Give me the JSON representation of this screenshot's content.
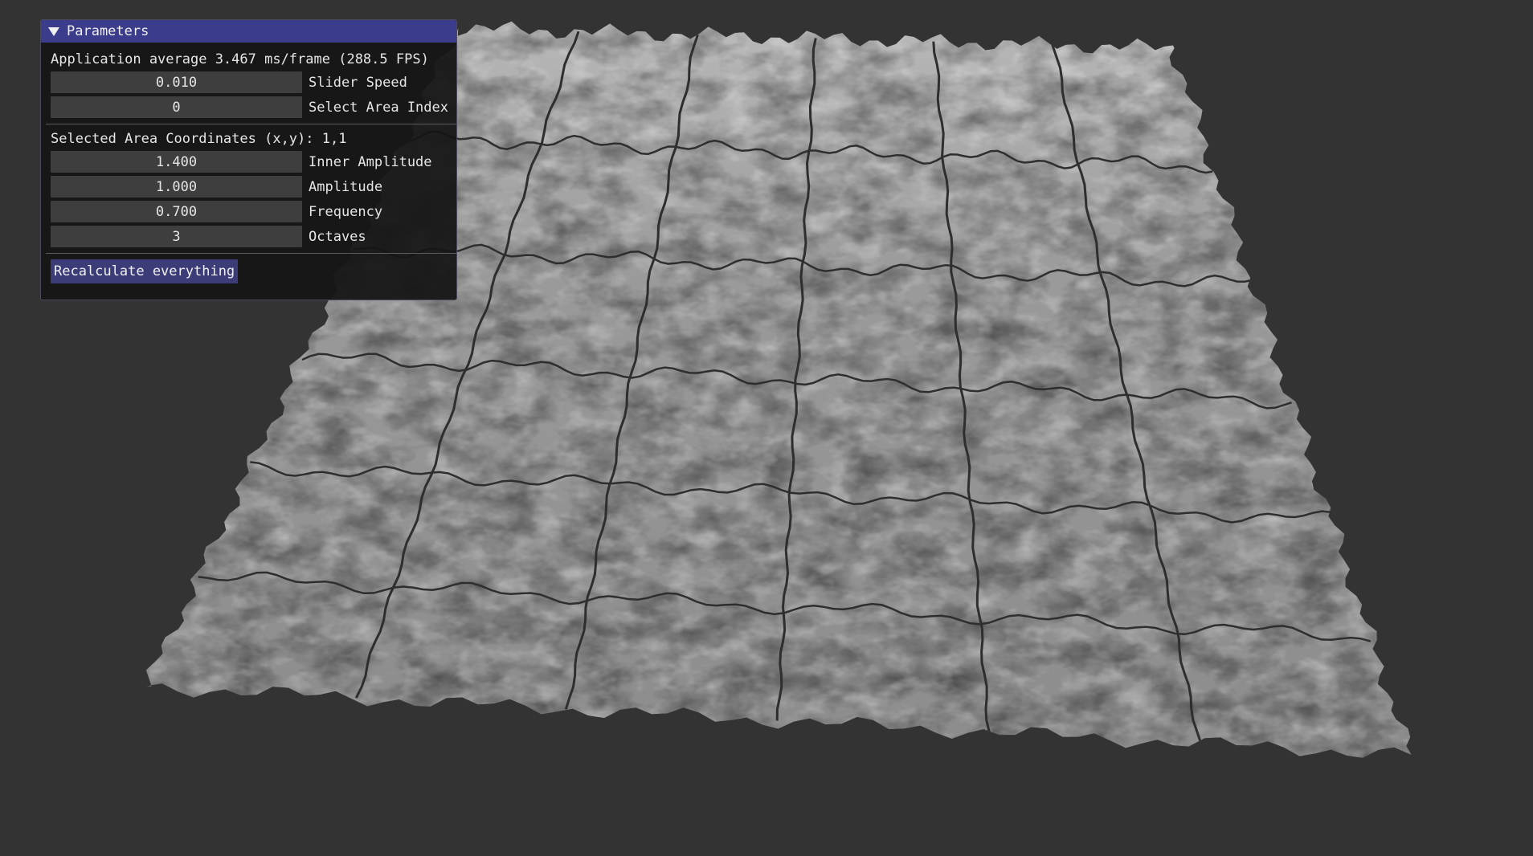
{
  "window": {
    "title": "Parameters",
    "fps_text": "Application average 3.467 ms/frame (288.5 FPS)",
    "slider_speed": {
      "value": "0.010",
      "label": "Slider Speed"
    },
    "select_area_index": {
      "value": "0",
      "label": "Select Area Index"
    },
    "selected_area_coordinates": "Selected Area Coordinates (x,y): 1,1",
    "inner_amplitude": {
      "value": "1.400",
      "label": "Inner Amplitude"
    },
    "amplitude": {
      "value": "1.000",
      "label": "Amplitude"
    },
    "frequency": {
      "value": "0.700",
      "label": "Frequency"
    },
    "octaves": {
      "value": "3",
      "label": "Octaves"
    },
    "recalculate_button": "Recalculate everything"
  },
  "colors": {
    "background": "#333333",
    "title_bar": "#3c3c8c",
    "button": "#3c3c78",
    "terrain_light": "#bdbdbd",
    "terrain_dark": "#5a5a5a",
    "grid_line": "#2e2e2e"
  },
  "scene": {
    "type": "3d-terrain",
    "grid_columns": 6,
    "grid_rows": 6,
    "selected_area": "1,1"
  }
}
